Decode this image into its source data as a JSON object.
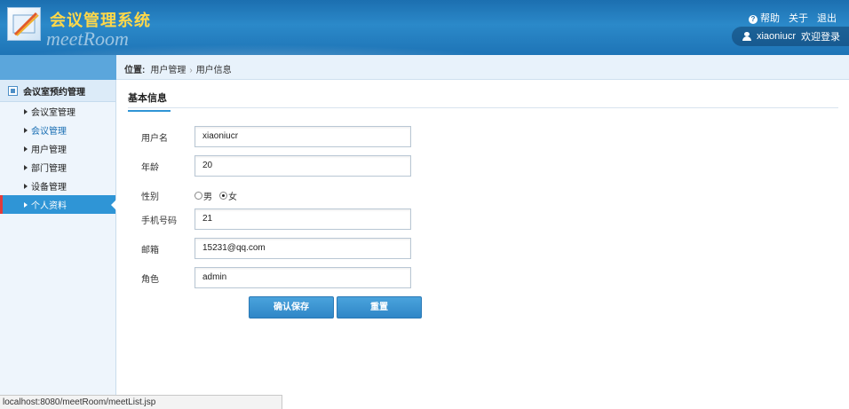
{
  "header": {
    "title": "会议管理系统",
    "subtitle": "meetRoom",
    "links": {
      "help": "帮助",
      "about": "关于",
      "logout": "退出"
    },
    "user": {
      "name": "xiaoniucr",
      "greeting": "欢迎登录"
    }
  },
  "breadcrumb": {
    "label": "位置:",
    "items": [
      "用户管理",
      "用户信息"
    ]
  },
  "sidebar": {
    "group_title": "会议室预约管理",
    "items": [
      {
        "label": "会议室管理"
      },
      {
        "label": "会议管理"
      },
      {
        "label": "用户管理"
      },
      {
        "label": "部门管理"
      },
      {
        "label": "设备管理"
      },
      {
        "label": "个人资料"
      }
    ]
  },
  "form": {
    "section_title": "基本信息",
    "fields": {
      "username": {
        "label": "用户名",
        "value": "xiaoniucr"
      },
      "age": {
        "label": "年龄",
        "value": "20"
      },
      "gender": {
        "label": "性别",
        "options": [
          "男",
          "女"
        ],
        "selected": "女"
      },
      "phone": {
        "label": "手机号码",
        "value": "21"
      },
      "email": {
        "label": "邮箱",
        "value": "15231@qq.com"
      },
      "role": {
        "label": "角色",
        "value": "admin"
      }
    },
    "buttons": {
      "save": "确认保存",
      "reset": "重置"
    }
  },
  "statusbar": {
    "url": "localhost:8080/meetRoom/meetList.jsp"
  },
  "colors": {
    "accent": "#2f95d6",
    "title_yellow": "#ffd84a",
    "active_marker": "#e23b3b"
  }
}
